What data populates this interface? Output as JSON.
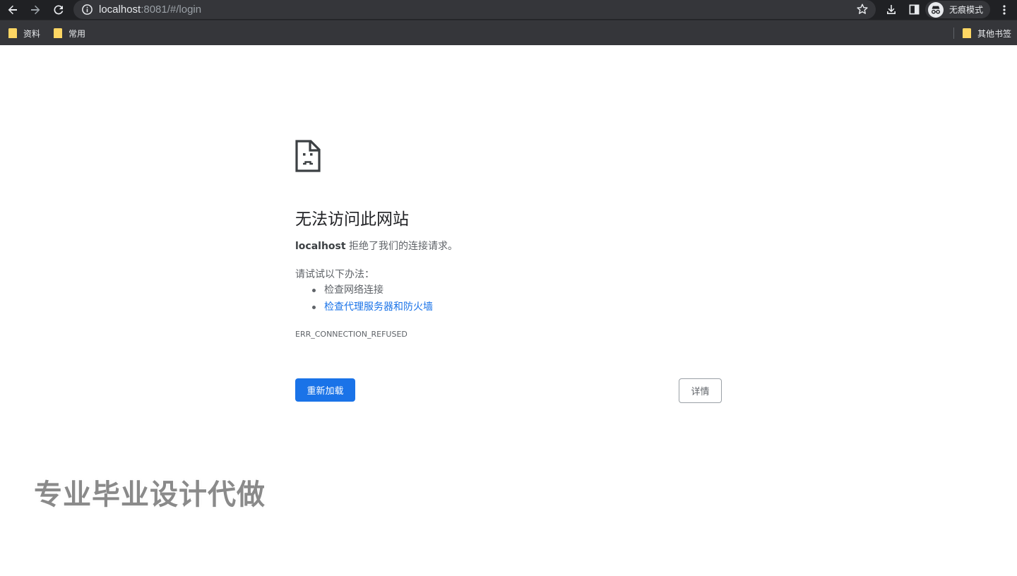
{
  "browser": {
    "url_host": "localhost",
    "url_rest": ":8081/#/login",
    "incognito_label": "无痕模式"
  },
  "bookmarks": {
    "items": [
      {
        "label": "资料"
      },
      {
        "label": "常用"
      }
    ],
    "other_label": "其他书签"
  },
  "error_page": {
    "title": "无法访问此网站",
    "host": "localhost",
    "message": " 拒绝了我们的连接请求。",
    "suggest_heading": "请试试以下办法：",
    "suggestions": [
      {
        "label": "检查网络连接",
        "is_link": false
      },
      {
        "label": "检查代理服务器和防火墙",
        "is_link": true
      }
    ],
    "error_code": "ERR_CONNECTION_REFUSED",
    "reload_label": "重新加载",
    "details_label": "详情"
  },
  "watermark": {
    "text": "专业毕业设计代做"
  },
  "colors": {
    "toolbar_bg": "#202124",
    "omnibox_bg": "#35363a",
    "accent": "#1a73e8",
    "folder": "#fdd663"
  },
  "icons": {
    "back": "arrow-left-icon",
    "forward": "arrow-right-icon",
    "reload": "reload-icon",
    "info": "info-icon",
    "bookmark_star": "star-icon",
    "download": "download-icon",
    "side_panel": "side-panel-icon",
    "incognito": "incognito-icon",
    "menu": "kebab-menu-icon",
    "folder": "folder-icon",
    "sad_page": "sad-page-icon"
  }
}
